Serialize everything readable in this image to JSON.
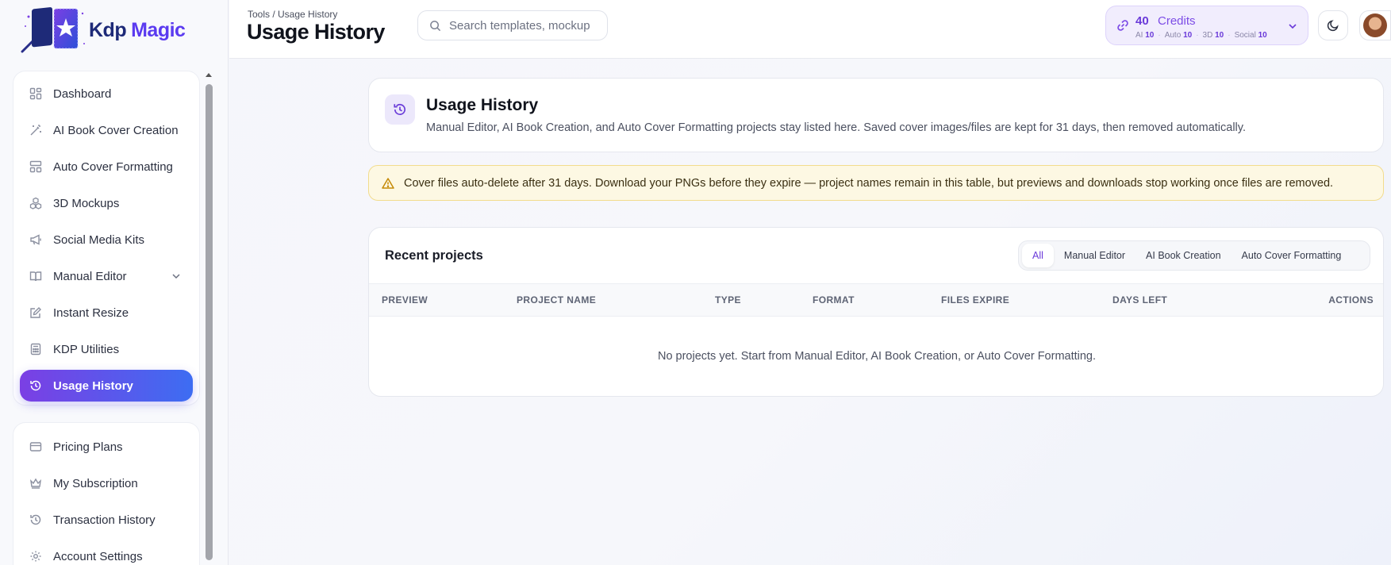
{
  "brand": {
    "word1": "Kdp",
    "word2": "Magic"
  },
  "sidebar": {
    "items": [
      {
        "label": "Dashboard",
        "icon": "dashboard-icon"
      },
      {
        "label": "AI Book Cover Creation",
        "icon": "magic-wand-icon"
      },
      {
        "label": "Auto Cover Formatting",
        "icon": "layout-icon"
      },
      {
        "label": "3D Mockups",
        "icon": "boxes-icon"
      },
      {
        "label": "Social Media Kits",
        "icon": "megaphone-icon"
      },
      {
        "label": "Manual Editor",
        "icon": "book-open-icon",
        "expandable": true
      },
      {
        "label": "Instant Resize",
        "icon": "resize-icon"
      },
      {
        "label": "KDP Utilities",
        "icon": "calculator-icon"
      },
      {
        "label": "Usage History",
        "icon": "history-icon",
        "active": true
      }
    ],
    "account_items": [
      {
        "label": "Pricing Plans",
        "icon": "credit-card-icon"
      },
      {
        "label": "My Subscription",
        "icon": "crown-icon"
      },
      {
        "label": "Transaction History",
        "icon": "history-icon"
      },
      {
        "label": "Account Settings",
        "icon": "gear-icon"
      }
    ]
  },
  "header": {
    "breadcrumb": "Tools / Usage History",
    "title": "Usage History",
    "search_placeholder": "Search templates, mockup",
    "credits": {
      "count": "40",
      "label": "Credits",
      "ai_label": "AI",
      "ai_value": "10",
      "auto_label": "Auto",
      "auto_value": "10",
      "3d_label": "3D",
      "3d_value": "10",
      "social_label": "Social",
      "social_value": "10"
    }
  },
  "info": {
    "title": "Usage History",
    "description": "Manual Editor, AI Book Creation, and Auto Cover Formatting projects stay listed here. Saved cover images/files are kept for 31 days, then removed automatically."
  },
  "warning": {
    "text": "Cover files auto-delete after 31 days. Download your PNGs before they expire — project names remain in this table, but previews and downloads stop working once files are removed."
  },
  "projects": {
    "heading": "Recent projects",
    "filters": [
      "All",
      "Manual Editor",
      "AI Book Creation",
      "Auto Cover Formatting"
    ],
    "active_filter": "All",
    "columns": [
      "PREVIEW",
      "PROJECT NAME",
      "TYPE",
      "FORMAT",
      "FILES EXPIRE",
      "DAYS LEFT",
      "ACTIONS"
    ],
    "empty_message": "No projects yet. Start from Manual Editor, AI Book Creation, or Auto Cover Formatting."
  },
  "colors": {
    "accent_purple": "#6a3ad9",
    "active_gradient_start": "#7b3fe4",
    "active_gradient_end": "#3d6df2",
    "warning_bg": "#fdf8e3"
  }
}
